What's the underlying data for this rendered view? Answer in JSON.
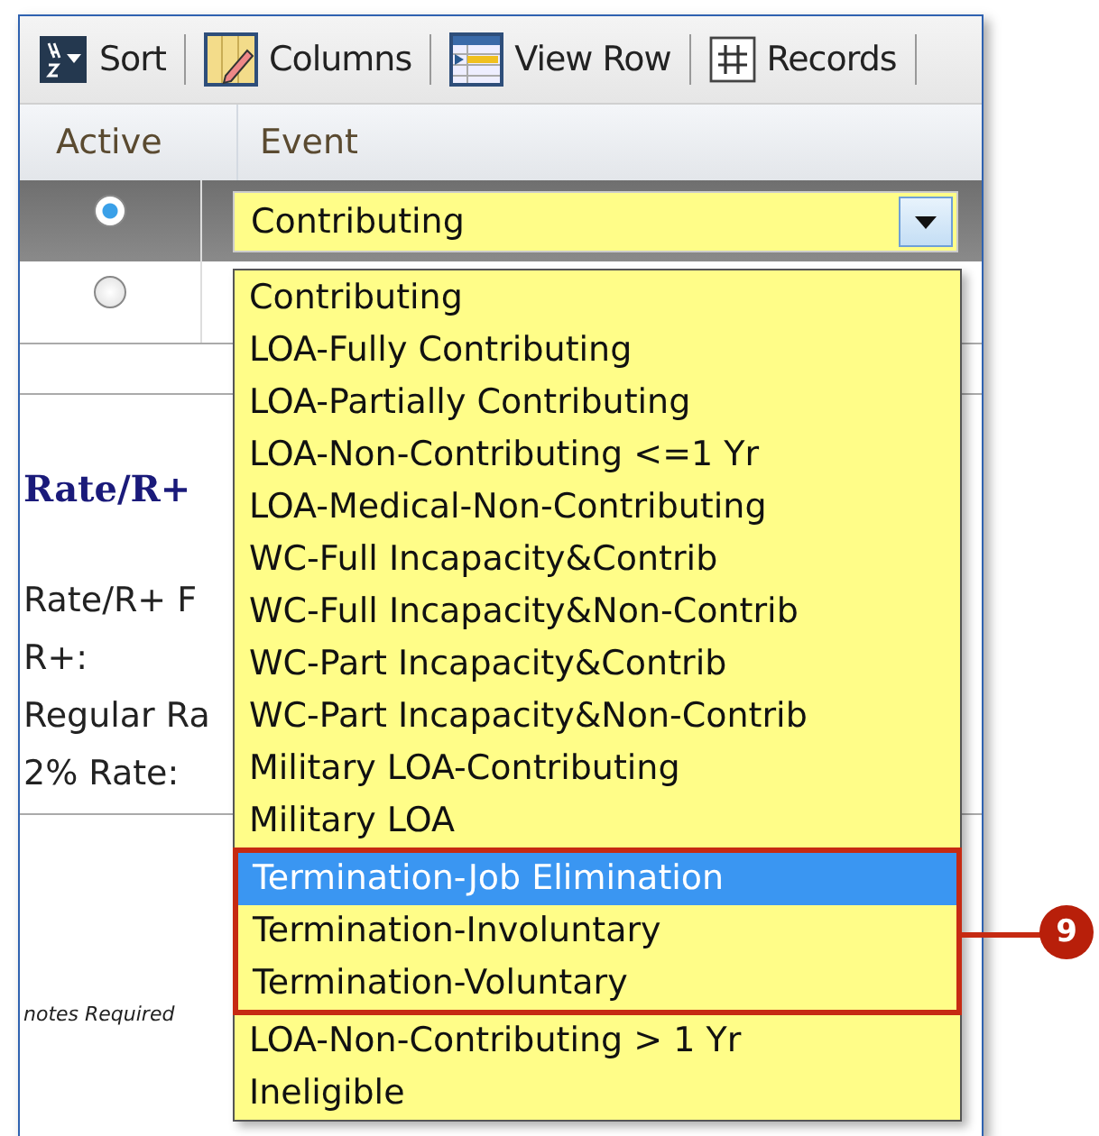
{
  "toolbar": [
    {
      "kind": "sort",
      "label": "Sort"
    },
    {
      "kind": "columns",
      "label": "Columns"
    },
    {
      "kind": "view-row",
      "label": "View Row"
    },
    {
      "kind": "records",
      "label": "Records"
    }
  ],
  "table": {
    "columns": [
      "Active",
      "Event"
    ],
    "rows": [
      {
        "selected": true,
        "event": "Contributing"
      },
      {
        "selected": false
      }
    ]
  },
  "section_title": "Rate/R+",
  "fields": [
    "Rate/R+ F",
    "R+:",
    "Regular Ra",
    "2% Rate:"
  ],
  "footnote": "notes Required",
  "dropdown": {
    "items": [
      {
        "label": "Contributing",
        "selected": false,
        "highlighted": false
      },
      {
        "label": "LOA-Fully Contributing",
        "selected": false,
        "highlighted": false
      },
      {
        "label": "LOA-Partially Contributing",
        "selected": false,
        "highlighted": false
      },
      {
        "label": "LOA-Non-Contributing <=1 Yr",
        "selected": false,
        "highlighted": false
      },
      {
        "label": "LOA-Medical-Non-Contributing",
        "selected": false,
        "highlighted": false
      },
      {
        "label": "WC-Full Incapacity&Contrib",
        "selected": false,
        "highlighted": false
      },
      {
        "label": "WC-Full Incapacity&Non-Contrib",
        "selected": false,
        "highlighted": false
      },
      {
        "label": "WC-Part Incapacity&Contrib",
        "selected": false,
        "highlighted": false
      },
      {
        "label": "WC-Part Incapacity&Non-Contrib",
        "selected": false,
        "highlighted": false
      },
      {
        "label": "Military LOA-Contributing",
        "selected": false,
        "highlighted": false
      },
      {
        "label": "Military LOA",
        "selected": false,
        "highlighted": false
      },
      {
        "label": "Termination-Job Elimination",
        "selected": true,
        "highlighted": true
      },
      {
        "label": "Termination-Involuntary",
        "selected": false,
        "highlighted": true
      },
      {
        "label": "Termination-Voluntary",
        "selected": false,
        "highlighted": true
      },
      {
        "label": "LOA-Non-Contributing > 1 Yr",
        "selected": false,
        "highlighted": false
      },
      {
        "label": "Ineligible",
        "selected": false,
        "highlighted": false
      }
    ]
  },
  "callout": {
    "number": "9"
  }
}
